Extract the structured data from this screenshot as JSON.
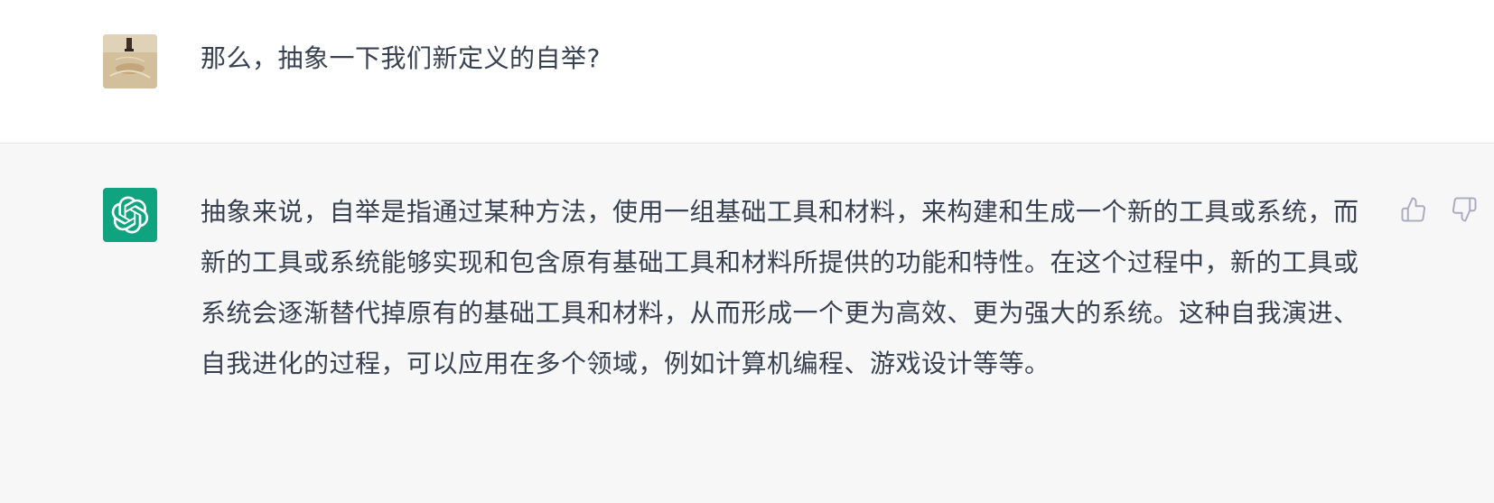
{
  "conversation": {
    "user_message": "那么，抽象一下我们新定义的自举?",
    "assistant_message": "抽象来说，自举是指通过某种方法，使用一组基础工具和材料，来构建和生成一个新的工具或系统，而新的工具或系统能够实现和包含原有基础工具和材料所提供的功能和特性。在这个过程中，新的工具或系统会逐渐替代掉原有的基础工具和材料，从而形成一个更为高效、更为强大的系统。这种自我演进、自我进化的过程，可以应用在多个领域，例如计算机编程、游戏设计等等。"
  },
  "icons": {
    "user_avatar": "user-photo-avatar",
    "assistant_avatar": "openai-logo-icon",
    "thumbs_up": "thumbs-up-icon",
    "thumbs_down": "thumbs-down-icon"
  },
  "colors": {
    "assistant_avatar_bg": "#10a37f",
    "assistant_row_bg": "#f7f7f8",
    "text": "#374151",
    "icon": "#acacbe"
  }
}
